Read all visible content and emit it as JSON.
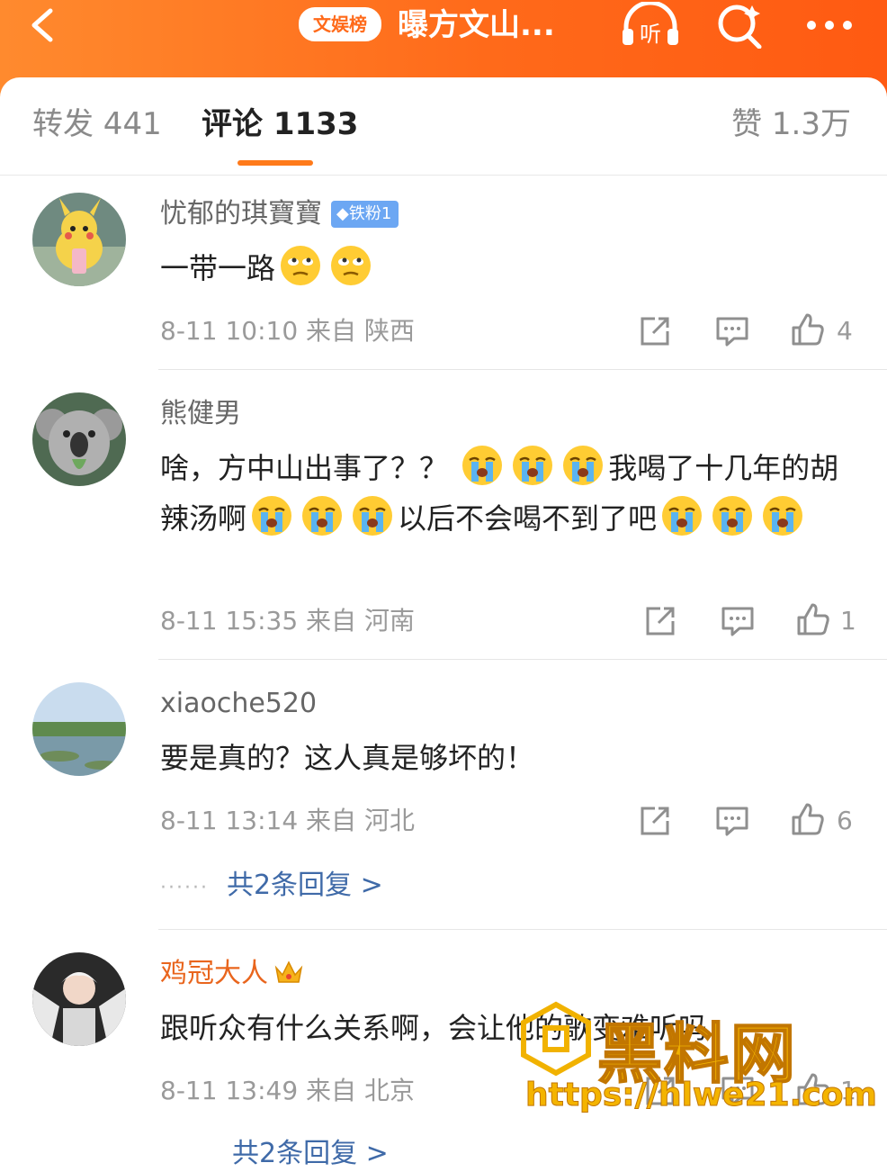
{
  "header": {
    "badge": "文娱榜",
    "title": "曝方文山...",
    "listen_label": "听",
    "accent_color": "#ff6a1a"
  },
  "tabs": {
    "repost": "转发 441",
    "comments": "评论 1133",
    "likes": "赞 1.3万"
  },
  "comments": [
    {
      "user": "忧郁的琪寶寶",
      "badge": "铁粉1",
      "text": "一带一路",
      "emojis_after_text": [
        "eye-roll-emoji",
        "eye-roll-emoji"
      ],
      "time": "8-11 10:10",
      "from_label": "来自",
      "location": "陕西",
      "likes": "4",
      "avatar": "pikachu-avatar"
    },
    {
      "user": "熊健男",
      "segments": {
        "a": "啥，方中山出事了？？",
        "b": "我喝了十几年",
        "c": "的胡辣汤啊",
        "d": "以后不会喝不到了吧"
      },
      "time": "8-11 15:35",
      "from_label": "来自",
      "location": "河南",
      "likes": "1",
      "avatar": "koala-avatar"
    },
    {
      "user": "xiaoche520",
      "text": "要是真的？这人真是够坏的！",
      "time": "8-11 13:14",
      "from_label": "来自",
      "location": "河北",
      "likes": "6",
      "replies": "共2条回复 >",
      "avatar": "lake-avatar"
    },
    {
      "user": "鸡冠大人",
      "text": "跟听众有什么关系啊，会让他的歌变难听吗",
      "time": "8-11 13:49",
      "from_label": "来自",
      "location": "北京",
      "likes": "1",
      "replies": "共2条回复 >",
      "avatar": "performer-avatar"
    }
  ],
  "watermark": {
    "text": "黑料网",
    "url": "https://hlwe21.com"
  }
}
